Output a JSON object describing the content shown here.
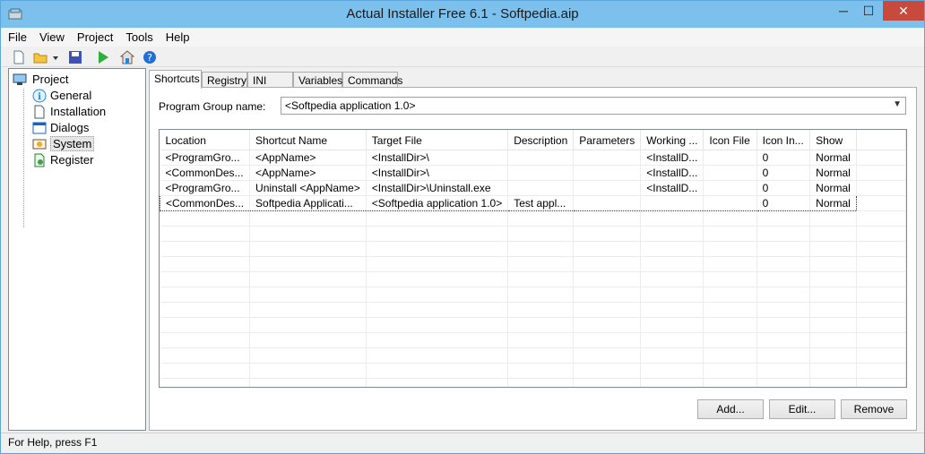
{
  "window": {
    "title": "Actual Installer Free 6.1 - Softpedia.aip"
  },
  "menu": [
    "File",
    "View",
    "Project",
    "Tools",
    "Help"
  ],
  "toolbar_icons": [
    "new-file-icon",
    "open-folder-icon",
    "dropdown-arrow-icon",
    "save-icon",
    "run-icon",
    "home-icon",
    "help-icon"
  ],
  "tree": {
    "root": "Project",
    "items": [
      {
        "label": "General",
        "icon": "info-icon"
      },
      {
        "label": "Installation",
        "icon": "document-icon"
      },
      {
        "label": "Dialogs",
        "icon": "dialogs-icon"
      },
      {
        "label": "System",
        "icon": "system-icon",
        "selected": true
      },
      {
        "label": "Register",
        "icon": "register-icon"
      }
    ]
  },
  "tabs": [
    "Shortcuts",
    "Registry",
    "INI Files",
    "Variables",
    "Commands"
  ],
  "program_group": {
    "label": "Program Group name:",
    "value": "<Softpedia application 1.0>"
  },
  "table": {
    "columns": [
      "Location",
      "Shortcut Name",
      "Target File",
      "Description",
      "Parameters",
      "Working ...",
      "Icon File",
      "Icon In...",
      "Show"
    ],
    "rows": [
      [
        "<ProgramGro...",
        "<AppName>",
        "<InstallDir>\\",
        "",
        "",
        "<InstallD...",
        "",
        "0",
        "Normal"
      ],
      [
        "<CommonDes...",
        "<AppName>",
        "<InstallDir>\\",
        "",
        "",
        "<InstallD...",
        "",
        "0",
        "Normal"
      ],
      [
        "<ProgramGro...",
        "Uninstall <AppName>",
        "<InstallDir>\\Uninstall.exe",
        "",
        "",
        "<InstallD...",
        "",
        "0",
        "Normal"
      ],
      [
        "<CommonDes...",
        "Softpedia Applicati...",
        "<Softpedia application 1.0>",
        "Test appl...",
        "",
        "",
        "",
        "0",
        "Normal"
      ]
    ]
  },
  "buttons": {
    "add": "Add...",
    "edit": "Edit...",
    "remove": "Remove"
  },
  "status": "For Help, press F1"
}
